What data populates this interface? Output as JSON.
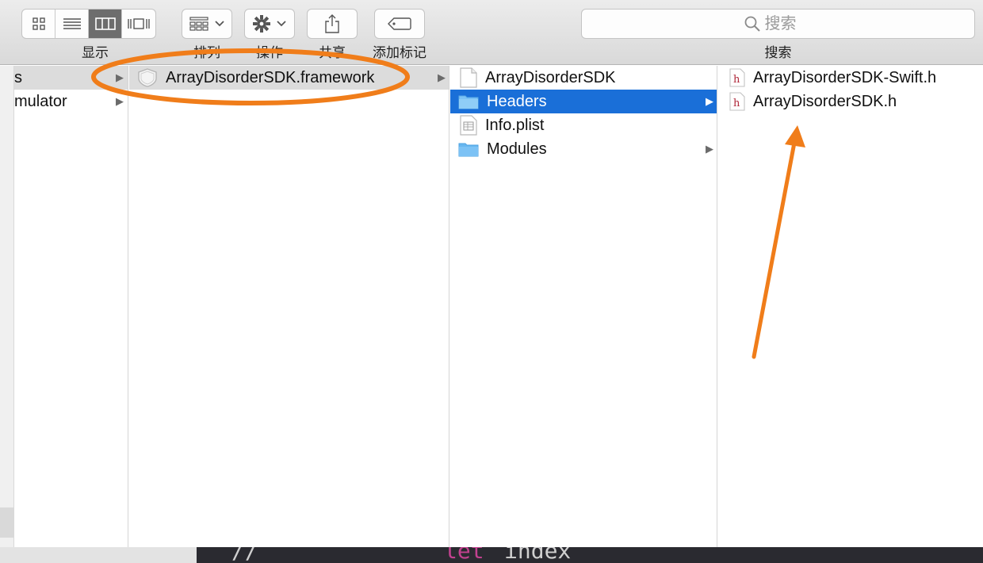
{
  "toolbar": {
    "view_label": "显示",
    "sort_label": "排列",
    "action_label": "操作",
    "share_label": "共享",
    "tag_label": "添加标记",
    "search_label": "搜索",
    "search_placeholder": "搜索"
  },
  "columns": {
    "col1": [
      {
        "label": "s",
        "has_arrow": true,
        "selected": true
      },
      {
        "label": "mulator",
        "has_arrow": true,
        "selected": false
      }
    ],
    "col2": [
      {
        "label": "ArrayDisorderSDK.framework",
        "has_arrow": true,
        "selected": true
      }
    ],
    "col3": [
      {
        "label": "ArrayDisorderSDK",
        "icon": "document-icon"
      },
      {
        "label": "Headers",
        "icon": "folder-icon",
        "has_arrow": true,
        "selected": true
      },
      {
        "label": "Info.plist",
        "icon": "plist-icon"
      },
      {
        "label": "Modules",
        "icon": "folder-icon",
        "has_arrow": true
      }
    ],
    "col4": [
      {
        "label": "ArrayDisorderSDK-Swift.h",
        "icon": "header-file-icon"
      },
      {
        "label": "ArrayDisorderSDK.h",
        "icon": "header-file-icon"
      }
    ]
  },
  "bottom_code": {
    "text1": "//",
    "text2": "let",
    "text3": "index"
  },
  "colors": {
    "selection_blue": "#1a6fd8",
    "annotation_orange": "#f07d1a",
    "folder_blue": "#67b7f0"
  }
}
